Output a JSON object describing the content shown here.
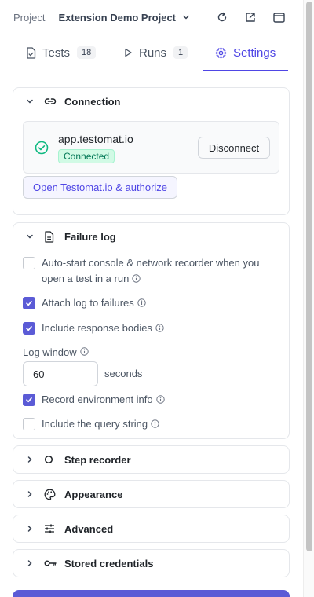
{
  "topbar": {
    "project_label": "Project",
    "project_name": "Extension Demo Project",
    "icons": [
      "refresh-icon",
      "external-link-icon",
      "window-icon"
    ]
  },
  "tabs": [
    {
      "label": "Tests",
      "count": "18",
      "icon": "file-check-icon"
    },
    {
      "label": "Runs",
      "count": "1",
      "icon": "play-icon"
    },
    {
      "label": "Settings",
      "icon": "gear-icon",
      "active": true
    }
  ],
  "connection": {
    "title": "Connection",
    "host": "app.testomat.io",
    "status": "Connected",
    "disconnect_label": "Disconnect",
    "open_label": "Open Testomat.io & authorize"
  },
  "failure_log": {
    "title": "Failure log",
    "options": [
      {
        "label": "Auto-start console & network recorder when you open a test in a run",
        "checked": false
      },
      {
        "label": "Attach log to failures",
        "checked": true
      },
      {
        "label": "Include response bodies",
        "checked": true
      },
      {
        "label": "Record environment info",
        "checked": true
      },
      {
        "label": "Include the query string",
        "checked": false
      }
    ],
    "log_window_label": "Log window",
    "log_window_value": "60",
    "log_window_unit": "seconds"
  },
  "sections": [
    {
      "title": "Step recorder",
      "icon": "circle-icon"
    },
    {
      "title": "Appearance",
      "icon": "palette-icon"
    },
    {
      "title": "Advanced",
      "icon": "sliders-icon"
    },
    {
      "title": "Stored credentials",
      "icon": "key-icon"
    }
  ],
  "colors": {
    "accent": "#4f46e5",
    "checkbox": "#5b5bd6",
    "success": "#10b981"
  }
}
